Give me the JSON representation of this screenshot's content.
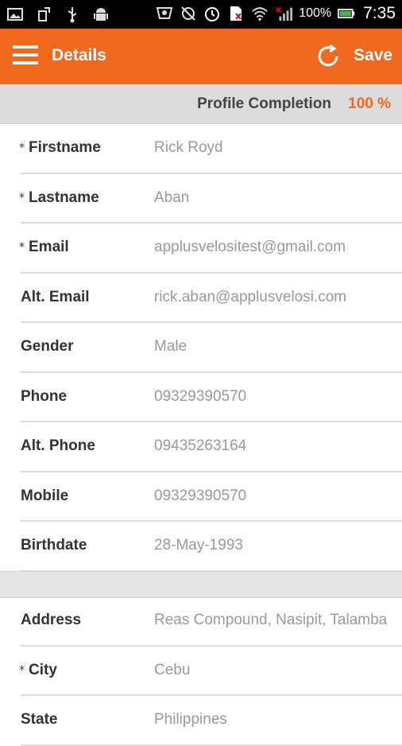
{
  "status_bar": {
    "left_icons": [
      "image-icon",
      "rotate-icon",
      "usb-icon",
      "android-icon"
    ],
    "right_icons": [
      "messenger-icon",
      "no-sync-icon",
      "alarm-icon",
      "sim-icon",
      "wifi-icon",
      "signal-icon"
    ],
    "battery_text": "100%",
    "time": "7:35"
  },
  "appbar": {
    "title": "Details",
    "save_label": "Save",
    "accent": "#ef6a1f"
  },
  "completion": {
    "label": "Profile Completion",
    "value": "100 %"
  },
  "fields": [
    {
      "required": true,
      "label": "Firstname",
      "value": "Rick Royd"
    },
    {
      "required": true,
      "label": "Lastname",
      "value": "Aban"
    },
    {
      "required": true,
      "label": "Email",
      "value": "applusvelositest@gmail.com"
    },
    {
      "required": false,
      "label": "Alt. Email",
      "value": "rick.aban@applusvelosi.com"
    },
    {
      "required": false,
      "label": "Gender",
      "value": "Male"
    },
    {
      "required": false,
      "label": "Phone",
      "value": "09329390570"
    },
    {
      "required": false,
      "label": "Alt. Phone",
      "value": "09435263164"
    },
    {
      "required": false,
      "label": "Mobile",
      "value": "09329390570"
    },
    {
      "required": false,
      "label": "Birthdate",
      "value": "28-May-1993"
    }
  ],
  "fields2": [
    {
      "required": false,
      "label": "Address",
      "value": "Reas Compound, Nasipit, Talamba"
    },
    {
      "required": true,
      "label": "City",
      "value": "Cebu"
    },
    {
      "required": false,
      "label": "State",
      "value": "Philippines"
    }
  ],
  "required_marker": "*"
}
